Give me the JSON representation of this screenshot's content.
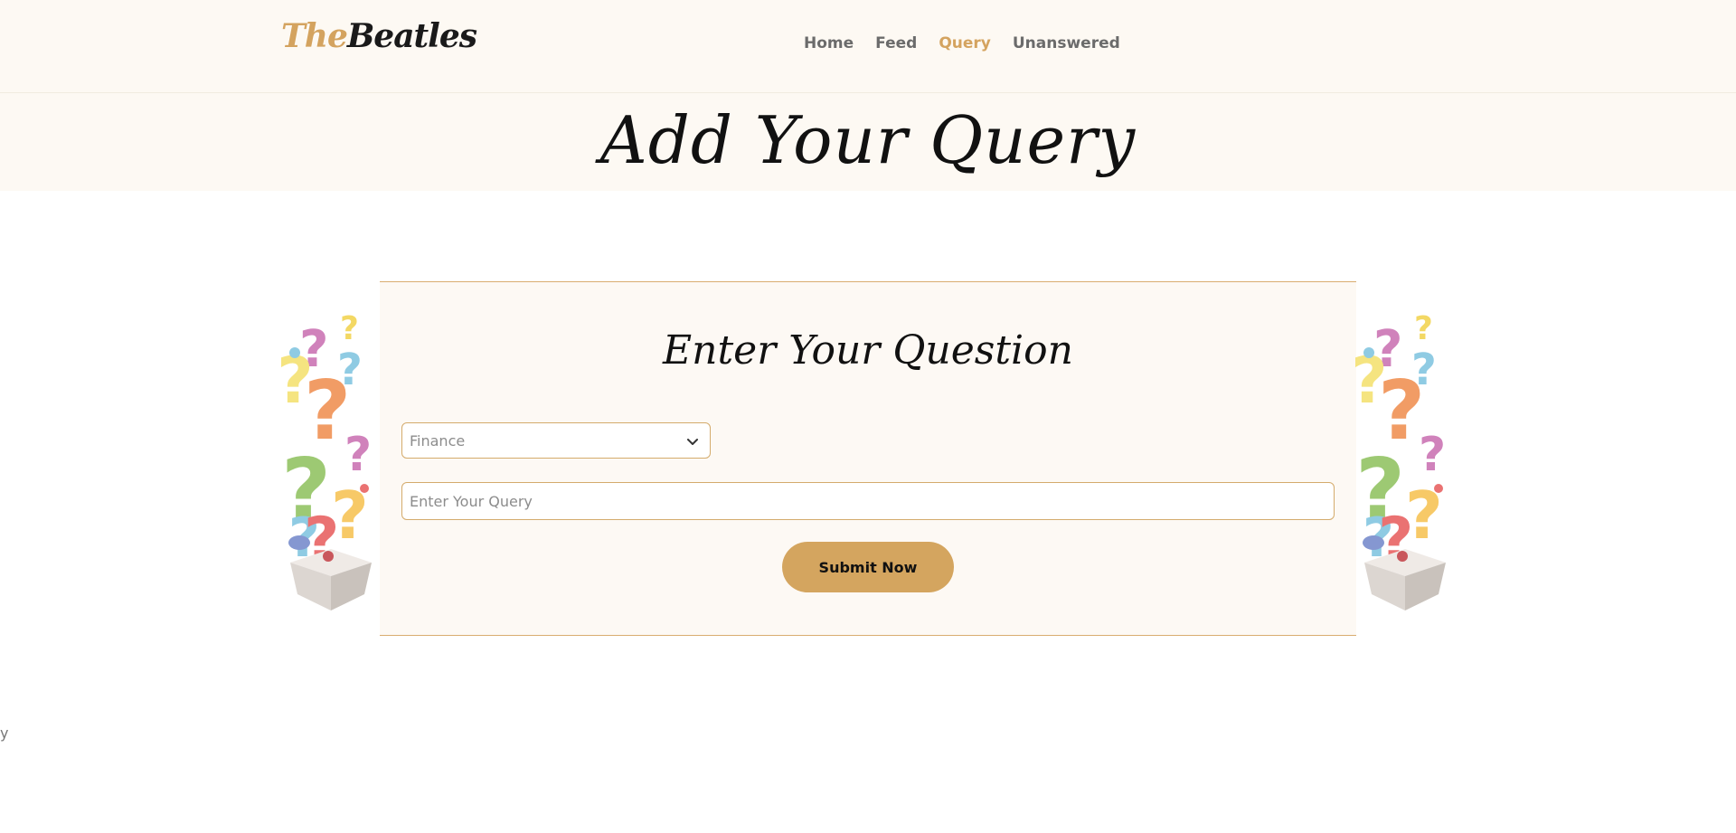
{
  "brand": {
    "part1": "The",
    "part2": "Beatles"
  },
  "nav": {
    "items": [
      {
        "label": "Home",
        "active": false
      },
      {
        "label": "Feed",
        "active": false
      },
      {
        "label": "Query",
        "active": true
      },
      {
        "label": "Unanswered",
        "active": false
      }
    ]
  },
  "banner": {
    "title": "Add Your Query"
  },
  "form": {
    "title": "Enter Your Question",
    "category": {
      "selected": "Finance"
    },
    "query": {
      "placeholder": "Enter Your Query",
      "value": ""
    },
    "submit_label": "Submit Now"
  },
  "footer": {
    "fragment": "y"
  },
  "colors": {
    "accent": "#d4a55f",
    "cream": "#fdf9f3",
    "border": "#d9ad70",
    "text": "#111111"
  }
}
